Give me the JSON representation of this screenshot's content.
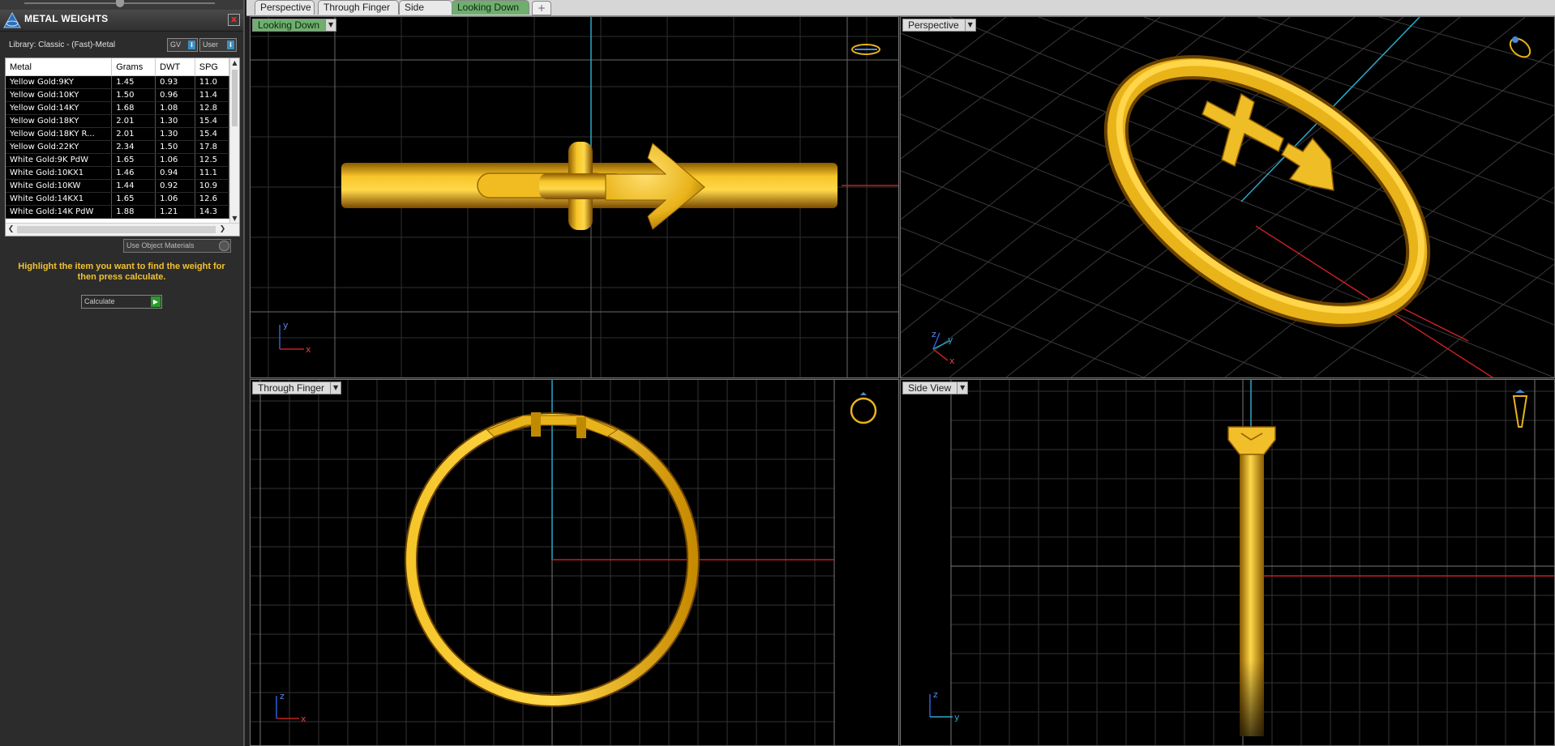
{
  "panel": {
    "title": "METAL WEIGHTS",
    "close_glyph": "x",
    "library_label": "Library: Classic - (Fast)-Metal",
    "gv_label": "GV",
    "user_label": "User",
    "indicator_glyph": "i",
    "table": {
      "headers": [
        "Metal",
        "Grams",
        "DWT",
        "SPG"
      ],
      "rows": [
        [
          "Yellow Gold:9KY",
          "1.45",
          "0.93",
          "11.0"
        ],
        [
          "Yellow Gold:10KY",
          "1.50",
          "0.96",
          "11.4"
        ],
        [
          "Yellow Gold:14KY",
          "1.68",
          "1.08",
          "12.8"
        ],
        [
          "Yellow Gold:18KY",
          "2.01",
          "1.30",
          "15.4"
        ],
        [
          "Yellow Gold:18KY R...",
          "2.01",
          "1.30",
          "15.4"
        ],
        [
          "Yellow Gold:22KY",
          "2.34",
          "1.50",
          "17.8"
        ],
        [
          "White Gold:9K PdW",
          "1.65",
          "1.06",
          "12.5"
        ],
        [
          "White Gold:10KX1",
          "1.46",
          "0.94",
          "11.1"
        ],
        [
          "White Gold:10KW",
          "1.44",
          "0.92",
          "10.9"
        ],
        [
          "White Gold:14KX1",
          "1.65",
          "1.06",
          "12.6"
        ],
        [
          "White Gold:14K PdW",
          "1.88",
          "1.21",
          "14.3"
        ]
      ]
    },
    "use_object_materials": "Use Object Materials",
    "instruction": "Highlight the item you want to find the weight for then press calculate.",
    "calculate_label": "Calculate"
  },
  "tabs": [
    {
      "label": "Perspective",
      "active": false
    },
    {
      "label": "Through Finger",
      "active": false
    },
    {
      "label": "Side View",
      "active": false
    },
    {
      "label": "Looking Down",
      "active": true
    }
  ],
  "add_tab_glyph": "+",
  "viewports": {
    "top": {
      "label": "Looking Down",
      "axis1": "y",
      "axis2": "x"
    },
    "persp": {
      "label": "Perspective",
      "axis1": "z",
      "axis2": "y",
      "axis3": "x"
    },
    "front": {
      "label": "Through Finger",
      "axis1": "z",
      "axis2": "x"
    },
    "side": {
      "label": "Side View",
      "axis1": "z",
      "axis2": "y"
    }
  },
  "colors": {
    "gold": "#e9b31a",
    "grid": "#3a3a3a",
    "axis_x": "#c42020",
    "axis_y": "#2aa8c8",
    "active_tab": "#6fae6f",
    "instruction": "#f2c230"
  }
}
